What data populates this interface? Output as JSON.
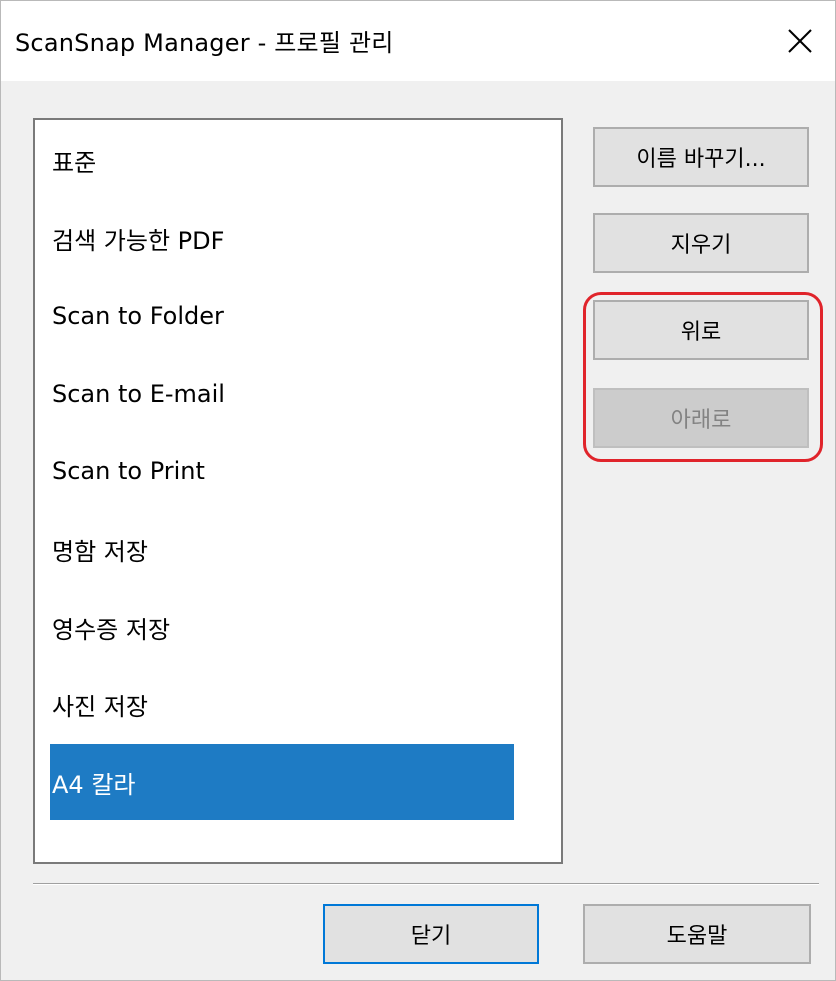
{
  "window": {
    "title": "ScanSnap Manager - 프로필 관리"
  },
  "profiles": [
    {
      "label": "표준"
    },
    {
      "label": "검색 가능한 PDF"
    },
    {
      "label": "Scan to Folder"
    },
    {
      "label": "Scan to E-mail"
    },
    {
      "label": "Scan to Print"
    },
    {
      "label": "명함 저장"
    },
    {
      "label": "영수증 저장"
    },
    {
      "label": "사진 저장"
    },
    {
      "label": "A4 칼라",
      "selected": true
    }
  ],
  "buttons": {
    "rename": "이름 바꾸기...",
    "delete": "지우기",
    "up": "위로",
    "down": "아래로",
    "close": "닫기",
    "help": "도움말"
  },
  "state": {
    "down_disabled": true,
    "highlight_color": "#e0242b",
    "selection_color": "#1e7bc4"
  }
}
